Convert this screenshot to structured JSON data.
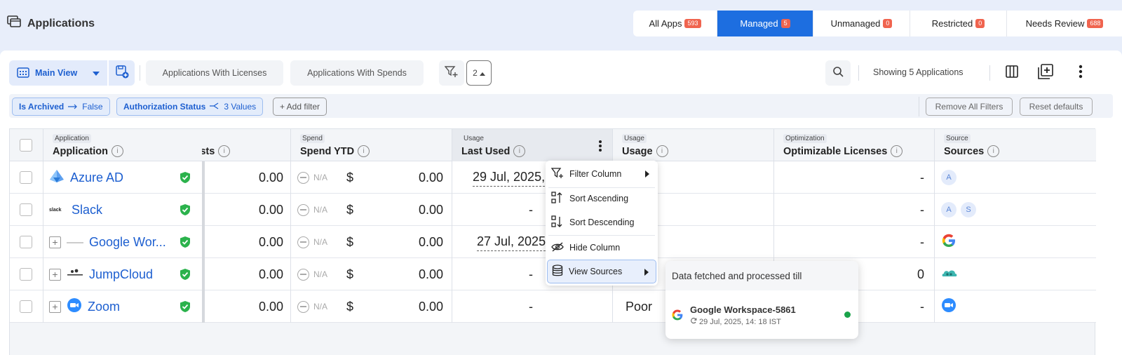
{
  "header": {
    "title": "Applications"
  },
  "tabs": [
    {
      "label": "All Apps",
      "count": "593",
      "active": false
    },
    {
      "label": "Managed",
      "count": "5",
      "active": true
    },
    {
      "label": "Unmanaged",
      "count": "0",
      "active": false
    },
    {
      "label": "Restricted",
      "count": "0",
      "active": false
    },
    {
      "label": "Needs Review",
      "count": "688",
      "active": false
    }
  ],
  "toolbar": {
    "view_label": "Main View",
    "pills": [
      "Applications With Licenses",
      "Applications With Spends"
    ],
    "filter_count": "2",
    "showing": "Showing 5 Applications"
  },
  "filters": {
    "chip1_label": "Is Archived",
    "chip1_value": "False",
    "chip2_label": "Authorization Status",
    "chip2_value": "3 Values",
    "add_filter": "+ Add filter",
    "remove_all": "Remove All Filters",
    "reset": "Reset defaults"
  },
  "columns": {
    "application": {
      "group": "Application",
      "label": "Application"
    },
    "costs": {
      "label": "Costs"
    },
    "spend": {
      "group": "Spend",
      "label": "Spend YTD"
    },
    "last_used": {
      "group": "Usage",
      "label": "Last Used"
    },
    "usage": {
      "group": "Usage",
      "label": "Usage"
    },
    "optimizable": {
      "group": "Optimization",
      "label": "Optimizable Licenses"
    },
    "sources": {
      "group": "Source",
      "label": "Sources"
    }
  },
  "rows": [
    {
      "name": "Azure AD",
      "costs": "0.00",
      "spend_na": "N/A",
      "currency": "$",
      "spend": "0.00",
      "last_used": "29 Jul, 2025,",
      "usage": "",
      "optimizable": "-",
      "sources": [
        "A"
      ],
      "expandable": false,
      "logo": "azure-logo"
    },
    {
      "name": "Slack",
      "costs": "0.00",
      "spend_na": "N/A",
      "currency": "$",
      "spend": "0.00",
      "last_used": "-",
      "usage": "",
      "optimizable": "-",
      "sources": [
        "A",
        "S"
      ],
      "expandable": false,
      "logo": "slack-logo",
      "logo_text": "slack"
    },
    {
      "name": "Google Wor...",
      "costs": "0.00",
      "spend_na": "N/A",
      "currency": "$",
      "spend": "0.00",
      "last_used": "27 Jul, 2025",
      "usage": "",
      "optimizable": "-",
      "sources": [],
      "expandable": true,
      "logo": "google-workspace-logo"
    },
    {
      "name": "JumpCloud",
      "costs": "0.00",
      "spend_na": "N/A",
      "currency": "$",
      "spend": "0.00",
      "last_used": "-",
      "usage": "",
      "optimizable": "0",
      "sources": [],
      "expandable": true,
      "logo": "jumpcloud-logo"
    },
    {
      "name": "Zoom",
      "costs": "0.00",
      "spend_na": "N/A",
      "currency": "$",
      "spend": "0.00",
      "last_used": "-",
      "usage": "Poor",
      "optimizable": "-",
      "sources": [],
      "expandable": true,
      "logo": "zoom-logo"
    }
  ],
  "context_menu": {
    "items": [
      "Filter Column",
      "Sort Ascending",
      "Sort Descending",
      "Hide Column",
      "View Sources"
    ]
  },
  "popover": {
    "title": "Data fetched and processed till",
    "source_name": "Google Workspace-5861",
    "source_time": "29 Jul, 2025, 14: 18 IST",
    "status_color": "#1aa34a"
  },
  "colors": {
    "accent": "#1d6ee0",
    "count_badge": "#f0644f",
    "verified": "#2bb24c"
  }
}
